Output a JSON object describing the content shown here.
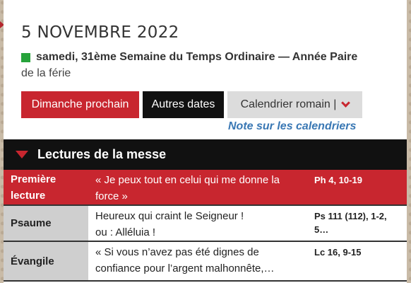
{
  "header": {
    "date": "5 NOVEMBRE 2022",
    "day_description": "samedi, 31ème Semaine du Temps Ordinaire — Année Paire",
    "liturgical_color": "#27a33b",
    "subtitle": "de la férie"
  },
  "buttons": {
    "next_sunday": "Dimanche prochain",
    "other_dates": "Autres dates",
    "roman_calendar": "Calendrier romain |"
  },
  "note_link": "Note sur les calendriers",
  "readings": {
    "title": "Lectures de la messe",
    "items": [
      {
        "label": "Première lecture",
        "text": "« Je peux tout en celui qui me donne la force »",
        "ref": "Ph 4, 10-19"
      },
      {
        "label": "Psaume",
        "text": "Heureux qui craint le Seigneur !",
        "text2": "ou : Alléluia !",
        "ref": "Ps 111 (112), 1-2, 5…"
      },
      {
        "label": "Évangile",
        "text": "« Si vous n’avez pas été dignes de confiance pour l’argent malhonnête,…",
        "ref": "Lc 16, 9-15"
      }
    ]
  },
  "colors": {
    "accent_red": "#c8262f",
    "link_blue": "#3a78b4",
    "dark": "#111111"
  }
}
